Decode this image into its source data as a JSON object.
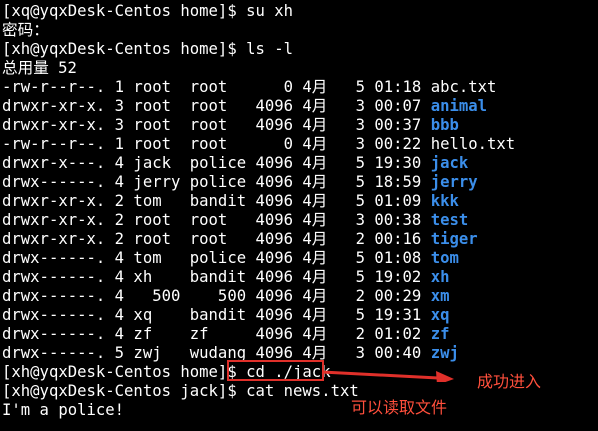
{
  "terminal": {
    "lines": [
      {
        "t": "[xq@yqxDesk-Centos home]$ su xh"
      },
      {
        "t": "密码："
      },
      {
        "t": "[xh@yqxDesk-Centos home]$ ls -l"
      },
      {
        "t": "总用量 52"
      },
      {
        "t": "-rw-r--r--. 1 root  root      0 4月   5 01:18 ",
        "name": "abc.txt",
        "dir": false
      },
      {
        "t": "drwxr-xr-x. 3 root  root   4096 4月   3 00:07 ",
        "name": "animal",
        "dir": true
      },
      {
        "t": "drwxr-xr-x. 3 root  root   4096 4月   3 00:37 ",
        "name": "bbb",
        "dir": true
      },
      {
        "t": "-rw-r--r--. 1 root  root      0 4月   3 00:22 ",
        "name": "hello.txt",
        "dir": false
      },
      {
        "t": "drwxr-x---. 4 jack  police 4096 4月   5 19:30 ",
        "name": "jack",
        "dir": true
      },
      {
        "t": "drwx------. 4 jerry police 4096 4月   5 18:59 ",
        "name": "jerry",
        "dir": true
      },
      {
        "t": "drwxr-xr-x. 2 tom   bandit 4096 4月   5 01:09 ",
        "name": "kkk",
        "dir": true
      },
      {
        "t": "drwxr-xr-x. 2 root  root   4096 4月   3 00:38 ",
        "name": "test",
        "dir": true
      },
      {
        "t": "drwxr-xr-x. 2 root  root   4096 4月   2 00:16 ",
        "name": "tiger",
        "dir": true
      },
      {
        "t": "drwx------. 4 tom   police 4096 4月   5 01:08 ",
        "name": "tom",
        "dir": true
      },
      {
        "t": "drwx------. 4 xh    bandit 4096 4月   5 19:02 ",
        "name": "xh",
        "dir": true
      },
      {
        "t": "drwx------. 4   500    500 4096 4月   2 00:29 ",
        "name": "xm",
        "dir": true
      },
      {
        "t": "drwx------. 4 xq    bandit 4096 4月   5 19:31 ",
        "name": "xq",
        "dir": true
      },
      {
        "t": "drwx------. 4 zf    zf     4096 4月   2 01:02 ",
        "name": "zf",
        "dir": true
      },
      {
        "t": "drwx------. 5 zwj   wudang 4096 4月   3 00:40 ",
        "name": "zwj",
        "dir": true
      },
      {
        "t": "[xh@yqxDesk-Centos home]$ cd ./jack"
      },
      {
        "t": "[xh@yqxDesk-Centos jack]$ cat news.txt"
      },
      {
        "t": "I'm a police!"
      }
    ]
  },
  "annotations": {
    "success_label": "成功进入",
    "file_label": "可以读取文件",
    "color": "#e0302a"
  }
}
